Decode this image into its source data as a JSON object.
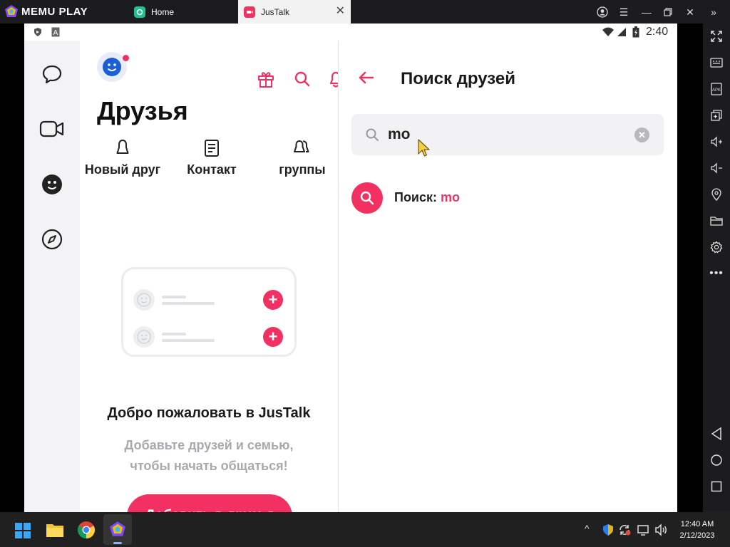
{
  "emulator": {
    "brand": "MEMU PLAY",
    "tabs": [
      {
        "label": "Home"
      },
      {
        "label": "JusTalk"
      }
    ]
  },
  "android": {
    "time": "2:40"
  },
  "friends": {
    "title": "Друзья",
    "actions": [
      {
        "label": "Новый друг"
      },
      {
        "label": "Контакт"
      },
      {
        "label": "группы"
      }
    ],
    "welcome_title": "Добро пожаловать в JusTalk",
    "welcome_line1": "Добавьте друзей и семью,",
    "welcome_line2": "чтобы начать общаться!",
    "add_button": "Добавить в друзья"
  },
  "search": {
    "title": "Поиск друзей",
    "query": "mo",
    "result_prefix": "Поиск:",
    "result_query": "mo"
  },
  "taskbar": {
    "time": "12:40 AM",
    "date": "2/12/2023"
  },
  "colors": {
    "accent": "#f23062",
    "avatar": "#1a5fd6",
    "titlebar": "#1c1c1e"
  }
}
